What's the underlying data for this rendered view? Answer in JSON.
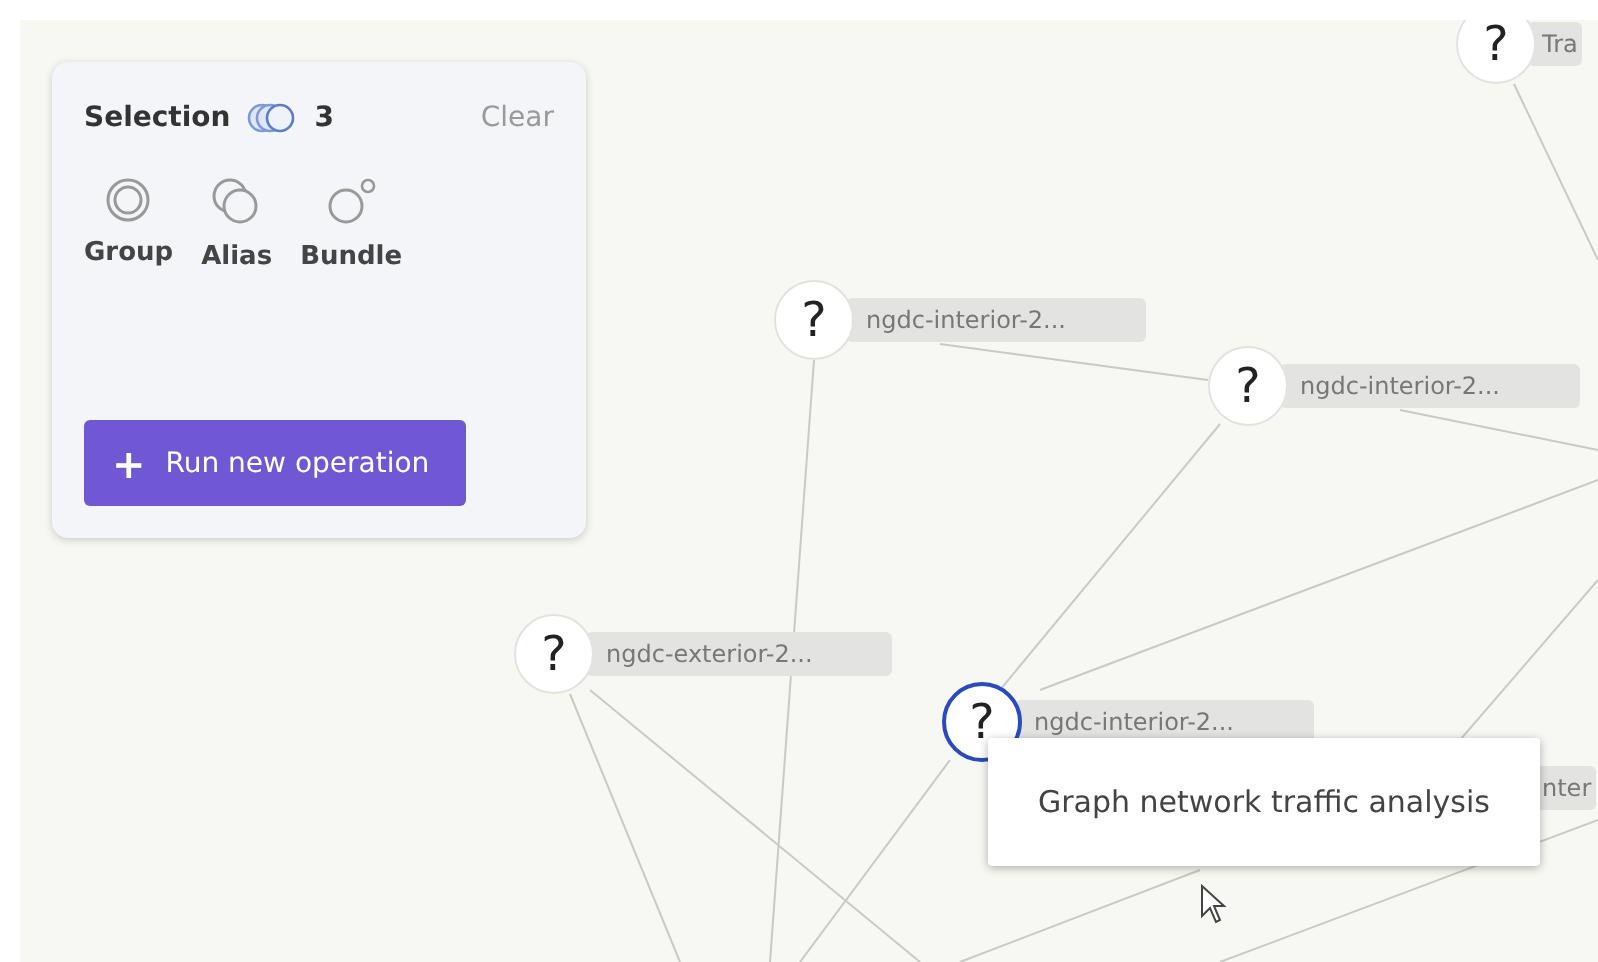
{
  "selection_panel": {
    "title": "Selection",
    "count": "3",
    "clear": "Clear",
    "actions": [
      {
        "kind": "group",
        "label": "Group"
      },
      {
        "kind": "alias",
        "label": "Alias"
      },
      {
        "kind": "bundle",
        "label": "Bundle"
      }
    ],
    "run_button": {
      "icon": "+",
      "label": "Run new operation"
    }
  },
  "graph": {
    "nodes": [
      {
        "glyph": "?",
        "label": "Tra",
        "selected": false
      },
      {
        "glyph": "?",
        "label": "ngdc-interior-2...",
        "selected": false
      },
      {
        "glyph": "?",
        "label": "ngdc-interior-2...",
        "selected": false
      },
      {
        "glyph": "?",
        "label": "ngdc-exterior-2...",
        "selected": false
      },
      {
        "glyph": "?",
        "label": "ngdc-interior-2...",
        "selected": true
      },
      {
        "label": "nter"
      }
    ],
    "tooltip": "Graph network traffic analysis"
  }
}
